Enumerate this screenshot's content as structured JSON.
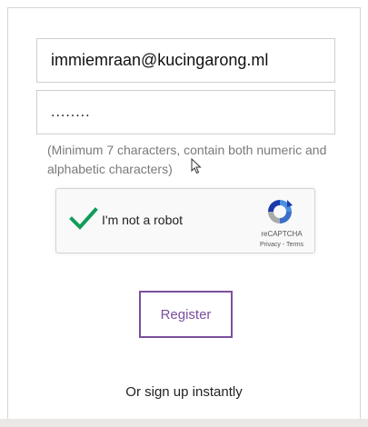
{
  "form": {
    "email_value": "immiemraan@kucingarong.ml",
    "password_value": "........",
    "password_hint": "(Minimum 7 characters, contain both numeric and alphabetic characters)"
  },
  "captcha": {
    "label": "I'm not a robot",
    "brand": "reCAPTCHA",
    "links": "Privacy - Terms",
    "checked": true,
    "check_color": "#0f9d58",
    "icon": "recaptcha-logo-icon"
  },
  "actions": {
    "register_label": "Register",
    "alt_signup_text": "Or sign up instantly"
  },
  "colors": {
    "accent": "#7b4f9d",
    "hint_text": "#7a7a7a"
  }
}
